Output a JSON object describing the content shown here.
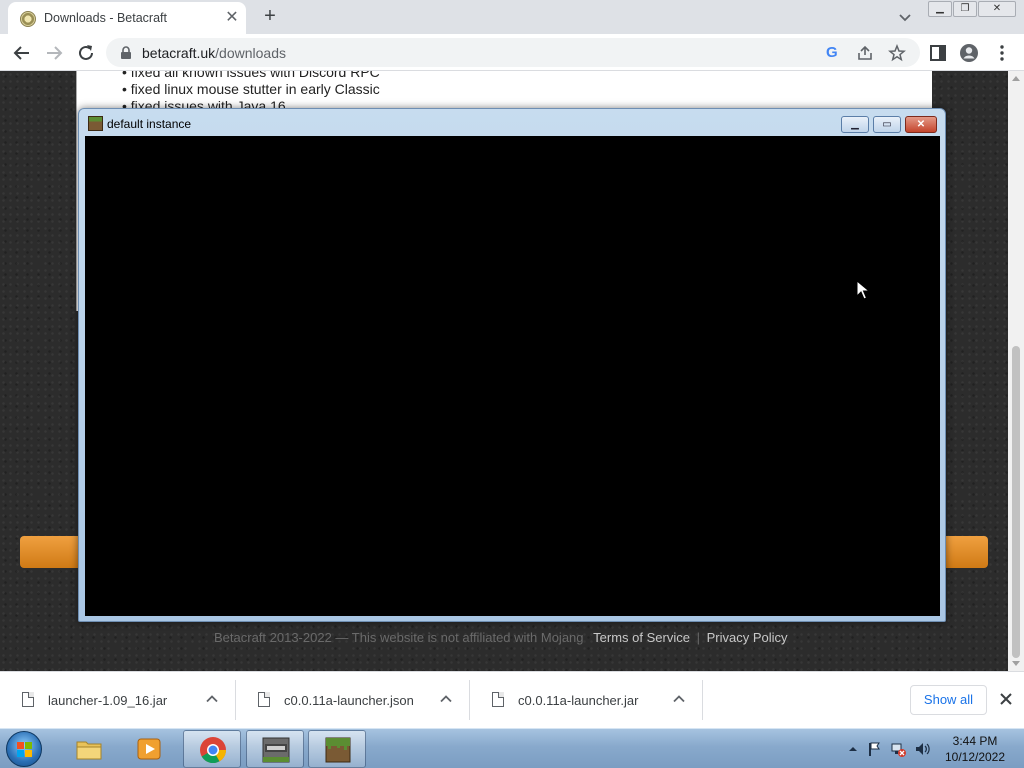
{
  "browser": {
    "tab_title": "Downloads - Betacraft",
    "url_host": "betacraft.uk",
    "url_path": "/downloads"
  },
  "page": {
    "changelog": [
      "• fixed all known issues with Discord RPC",
      "• fixed linux mouse stutter in early Classic",
      "• fixed issues with Java 16"
    ],
    "footer": {
      "copyright": "Betacraft 2013-2022 — This website is not affiliated with Mojang",
      "terms": "Terms of Service",
      "separator": "|",
      "privacy": "Privacy Policy"
    }
  },
  "game_window": {
    "title": "default instance"
  },
  "downloads": {
    "items": [
      {
        "name": "launcher-1.09_16.jar"
      },
      {
        "name": "c0.0.11a-launcher.json"
      },
      {
        "name": "c0.0.11a-launcher.jar"
      }
    ],
    "show_all": "Show all"
  },
  "taskbar": {
    "time": "3:44 PM",
    "date": "10/12/2022"
  }
}
